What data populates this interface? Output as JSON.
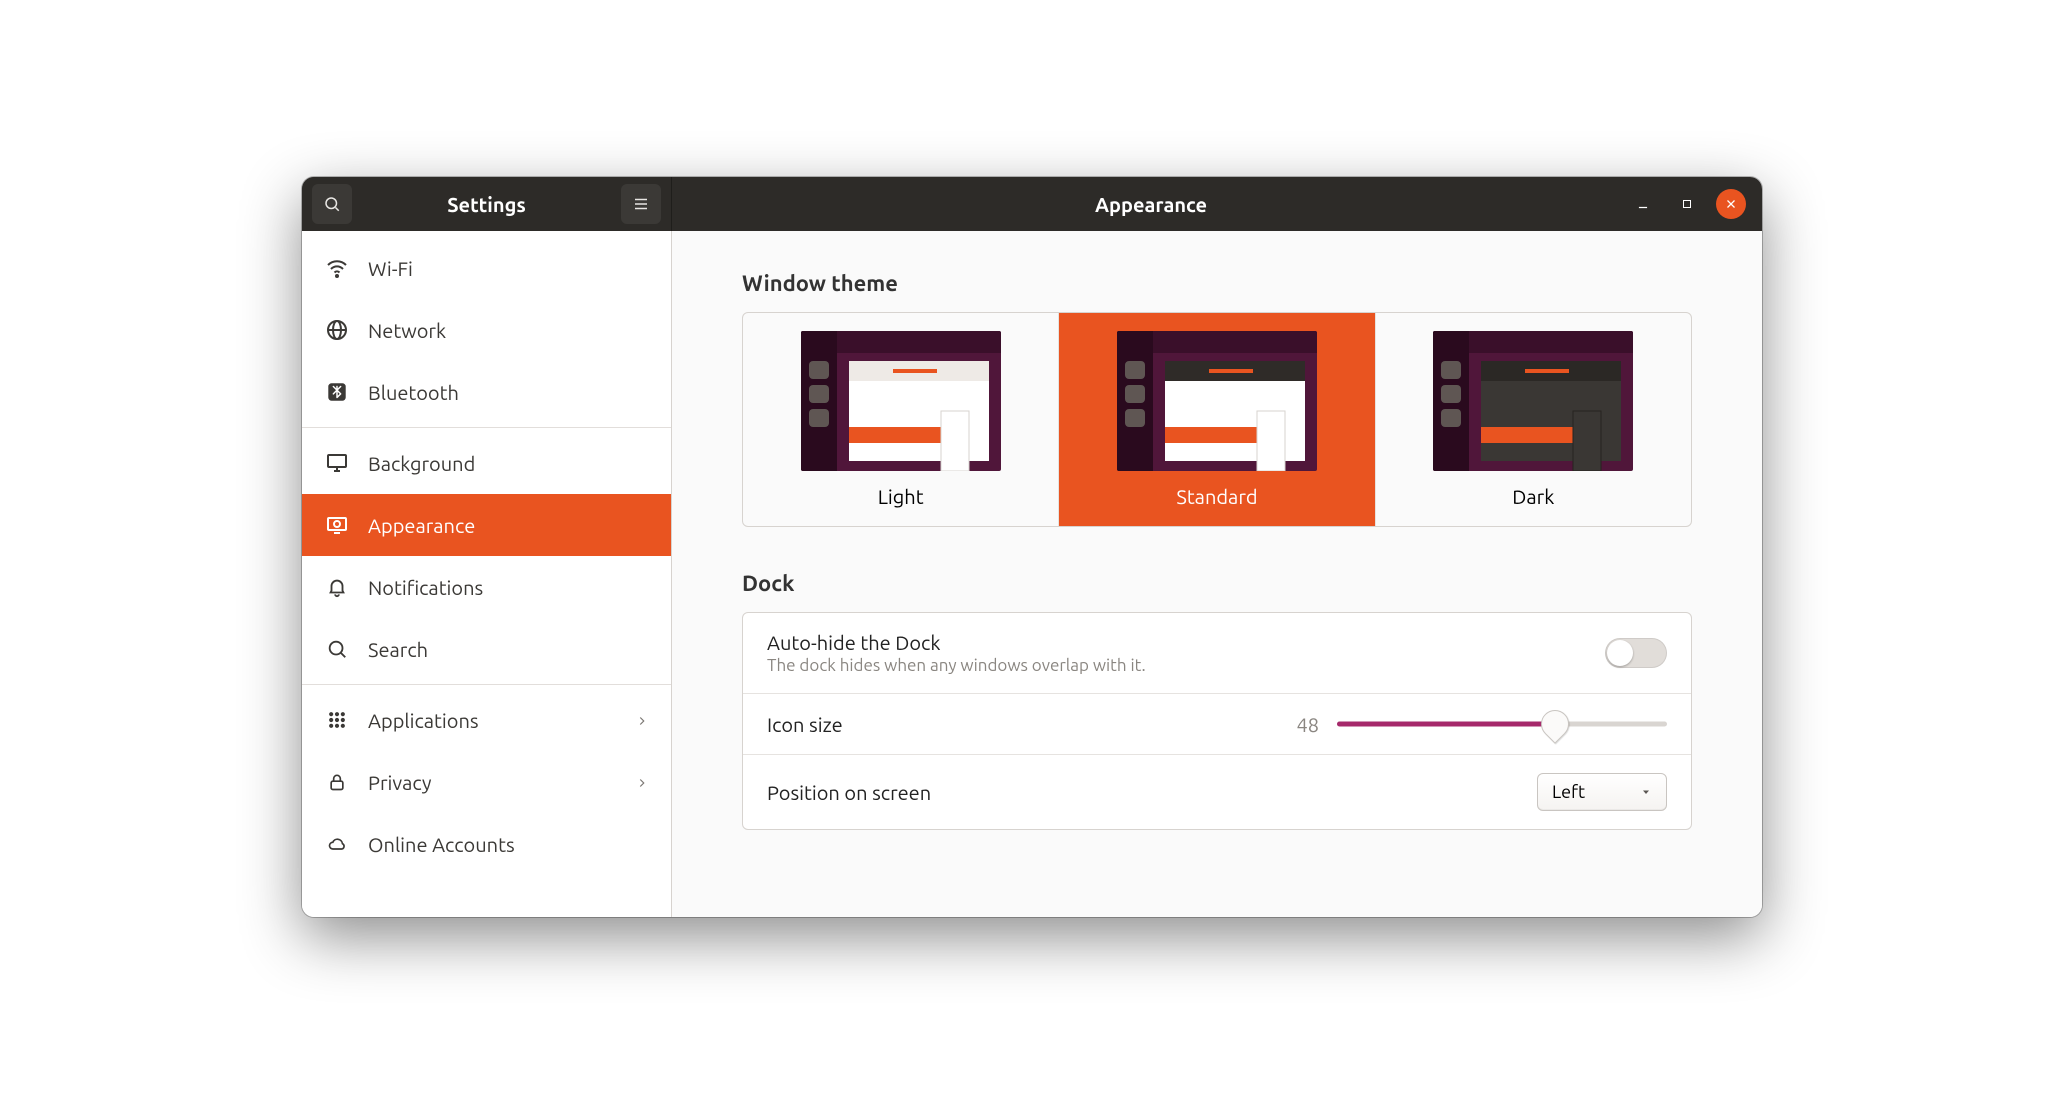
{
  "header": {
    "sidebar_title": "Settings",
    "panel_title": "Appearance"
  },
  "sidebar": {
    "items": [
      {
        "icon": "wifi",
        "label": "Wi-Fi"
      },
      {
        "icon": "globe",
        "label": "Network"
      },
      {
        "icon": "bluetooth",
        "label": "Bluetooth"
      },
      {
        "icon": "monitor",
        "label": "Background"
      },
      {
        "icon": "appearance",
        "label": "Appearance",
        "active": true
      },
      {
        "icon": "bell",
        "label": "Notifications"
      },
      {
        "icon": "search",
        "label": "Search"
      },
      {
        "icon": "grid",
        "label": "Applications",
        "chevron": true
      },
      {
        "icon": "lock",
        "label": "Privacy",
        "chevron": true
      },
      {
        "icon": "cloud",
        "label": "Online Accounts"
      }
    ]
  },
  "appearance": {
    "window_theme": {
      "title": "Window theme",
      "options": [
        {
          "key": "light",
          "label": "Light"
        },
        {
          "key": "standard",
          "label": "Standard",
          "active": true
        },
        {
          "key": "dark",
          "label": "Dark"
        }
      ]
    },
    "dock": {
      "title": "Dock",
      "autohide": {
        "label": "Auto-hide the Dock",
        "description": "The dock hides when any windows overlap with it.",
        "value": false
      },
      "icon_size": {
        "label": "Icon size",
        "value": 48,
        "min": 16,
        "max": 64
      },
      "position": {
        "label": "Position on screen",
        "value": "Left"
      }
    }
  },
  "colors": {
    "accent": "#e95420",
    "slider_fill": "#a6296b"
  }
}
